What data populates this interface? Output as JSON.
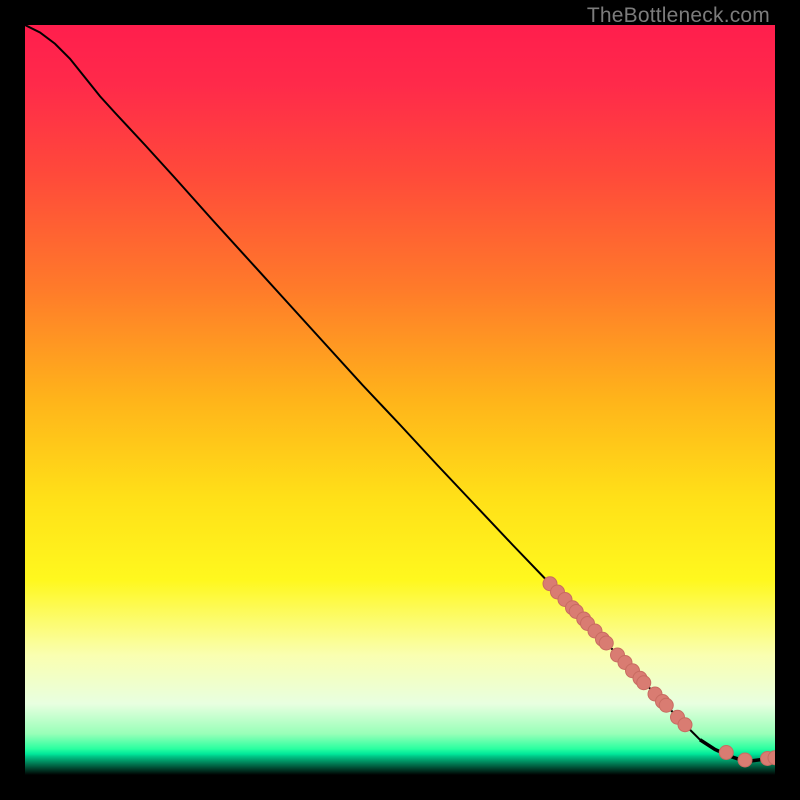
{
  "attribution": "TheBottleneck.com",
  "colors": {
    "curve": "#000000",
    "marker_fill": "#d97c72",
    "marker_stroke": "#c86b61",
    "gradient_stops": [
      {
        "offset": 0.0,
        "color": "#ff1e4d"
      },
      {
        "offset": 0.08,
        "color": "#ff2a4a"
      },
      {
        "offset": 0.2,
        "color": "#ff4a3a"
      },
      {
        "offset": 0.35,
        "color": "#ff7a2a"
      },
      {
        "offset": 0.5,
        "color": "#ffb41a"
      },
      {
        "offset": 0.63,
        "color": "#ffe018"
      },
      {
        "offset": 0.74,
        "color": "#fff81e"
      },
      {
        "offset": 0.84,
        "color": "#faffb0"
      },
      {
        "offset": 0.905,
        "color": "#e8ffe0"
      },
      {
        "offset": 0.945,
        "color": "#98ffb8"
      },
      {
        "offset": 0.965,
        "color": "#2affa0"
      },
      {
        "offset": 0.972,
        "color": "#00e89a"
      },
      {
        "offset": 0.975,
        "color": "#00c888"
      },
      {
        "offset": 1.0,
        "color": "#000000"
      }
    ]
  },
  "chart_data": {
    "type": "line",
    "title": "",
    "xlabel": "",
    "ylabel": "",
    "xlim": [
      0,
      100
    ],
    "ylim": [
      0,
      100
    ],
    "series": [
      {
        "name": "curve",
        "x": [
          0,
          2,
          4,
          6,
          8,
          10,
          12,
          16,
          20,
          25,
          30,
          35,
          40,
          45,
          50,
          55,
          60,
          65,
          70,
          75,
          80,
          85,
          88,
          90,
          92,
          94,
          95.5,
          97,
          98.5,
          100
        ],
        "y": [
          100,
          99,
          97.5,
          95.5,
          93,
          90.5,
          88.3,
          84,
          79.6,
          74,
          68.5,
          63,
          57.5,
          52,
          46.7,
          41.3,
          36,
          30.7,
          25.5,
          20.2,
          15,
          9.8,
          6.7,
          4.7,
          3.4,
          2.5,
          2.0,
          1.9,
          2.1,
          2.3
        ]
      }
    ],
    "markers": {
      "name": "points-on-curve",
      "x": [
        70,
        71,
        72,
        73,
        73.5,
        74.5,
        75,
        76,
        77,
        77.5,
        79,
        80,
        81,
        82,
        82.5,
        84,
        85,
        85.5,
        87,
        88,
        93.5,
        96,
        99,
        100
      ],
      "y": [
        25.5,
        24.4,
        23.4,
        22.3,
        21.8,
        20.8,
        20.2,
        19.2,
        18.1,
        17.6,
        16.0,
        15.0,
        13.9,
        12.9,
        12.3,
        10.8,
        9.8,
        9.3,
        7.7,
        6.7,
        3.0,
        2.0,
        2.2,
        2.3
      ]
    }
  }
}
